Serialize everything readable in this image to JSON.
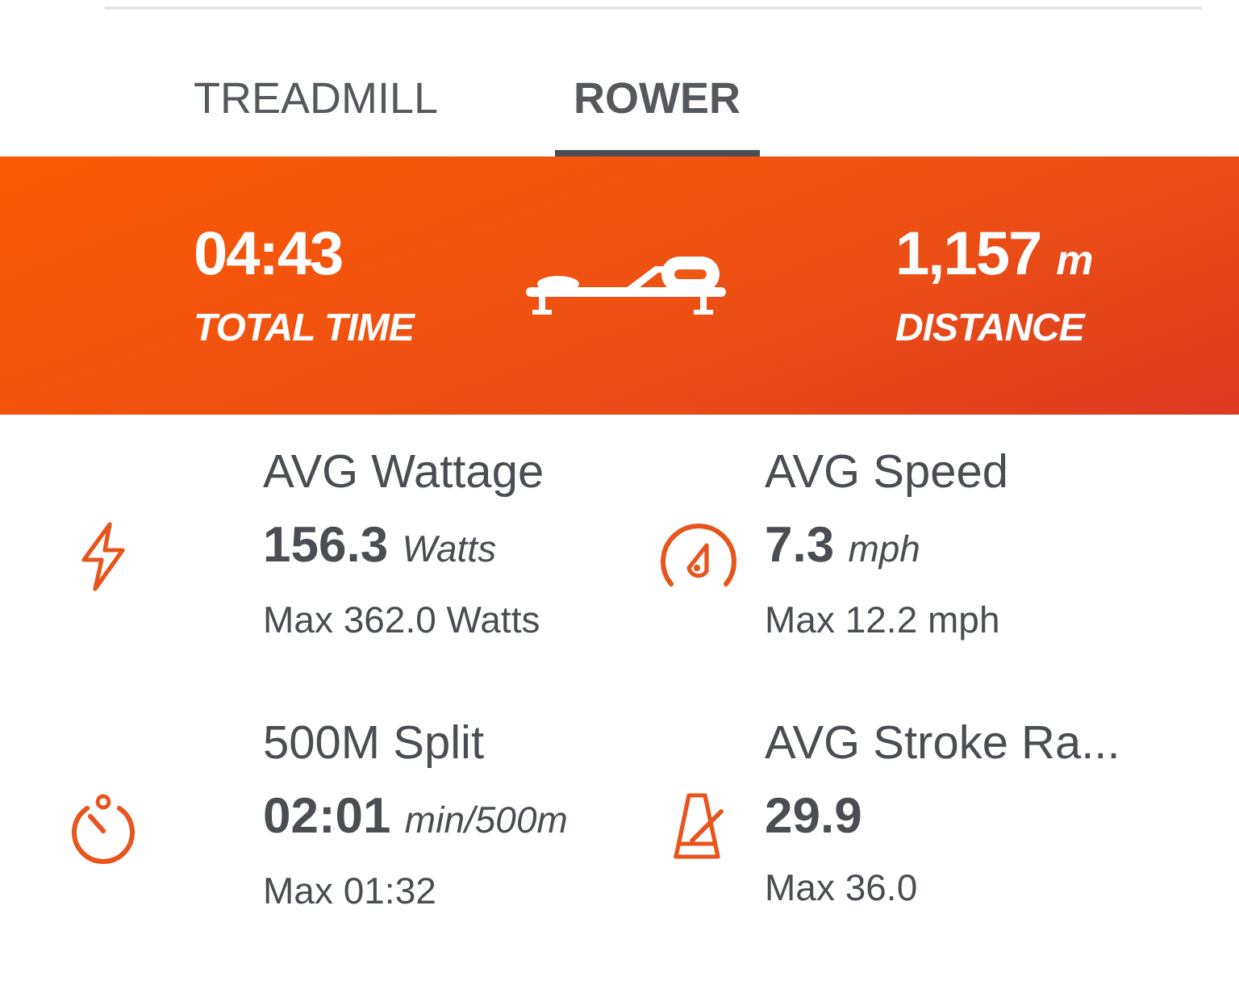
{
  "tabs": [
    {
      "label": "TREADMILL",
      "selected": false
    },
    {
      "label": "ROWER",
      "selected": true
    }
  ],
  "summary": {
    "left": {
      "value": "04:43",
      "label": "TOTAL TIME"
    },
    "right": {
      "value": "1,157",
      "unit": "m",
      "label": "DISTANCE"
    }
  },
  "metrics": [
    {
      "kind": "bolt",
      "title": "AVG Wattage",
      "value": "156.3",
      "unit": "Watts",
      "max": "Max 362.0 Watts"
    },
    {
      "kind": "gauge",
      "title": "AVG Speed",
      "value": "7.3",
      "unit": "mph",
      "max": "Max 12.2 mph"
    },
    {
      "kind": "stopwatch",
      "title": "500M Split",
      "value": "02:01",
      "unit": "min/500m",
      "max": "Max 01:32"
    },
    {
      "kind": "metronome",
      "title": "AVG Stroke Ra...",
      "value": "29.9",
      "max": "Max 36.0"
    }
  ]
}
